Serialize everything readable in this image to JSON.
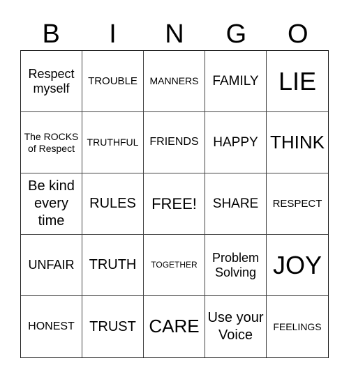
{
  "header": {
    "letters": [
      "B",
      "I",
      "N",
      "G",
      "O"
    ]
  },
  "cells": [
    "Respect myself",
    "TROUBLE",
    "MANNERS",
    "FAMILY",
    "LIE",
    "The ROCKS of Respect",
    "TRUTHFUL",
    "FRIENDS",
    "HAPPY",
    "THINK",
    "Be kind every time",
    "RULES",
    "FREE!",
    "SHARE",
    "RESPECT",
    "UNFAIR",
    "TRUTH",
    "TOGETHER",
    "Problem Solving",
    "JOY",
    "HONEST",
    "TRUST",
    "CARE",
    "Use your Voice",
    "FEELINGS"
  ]
}
